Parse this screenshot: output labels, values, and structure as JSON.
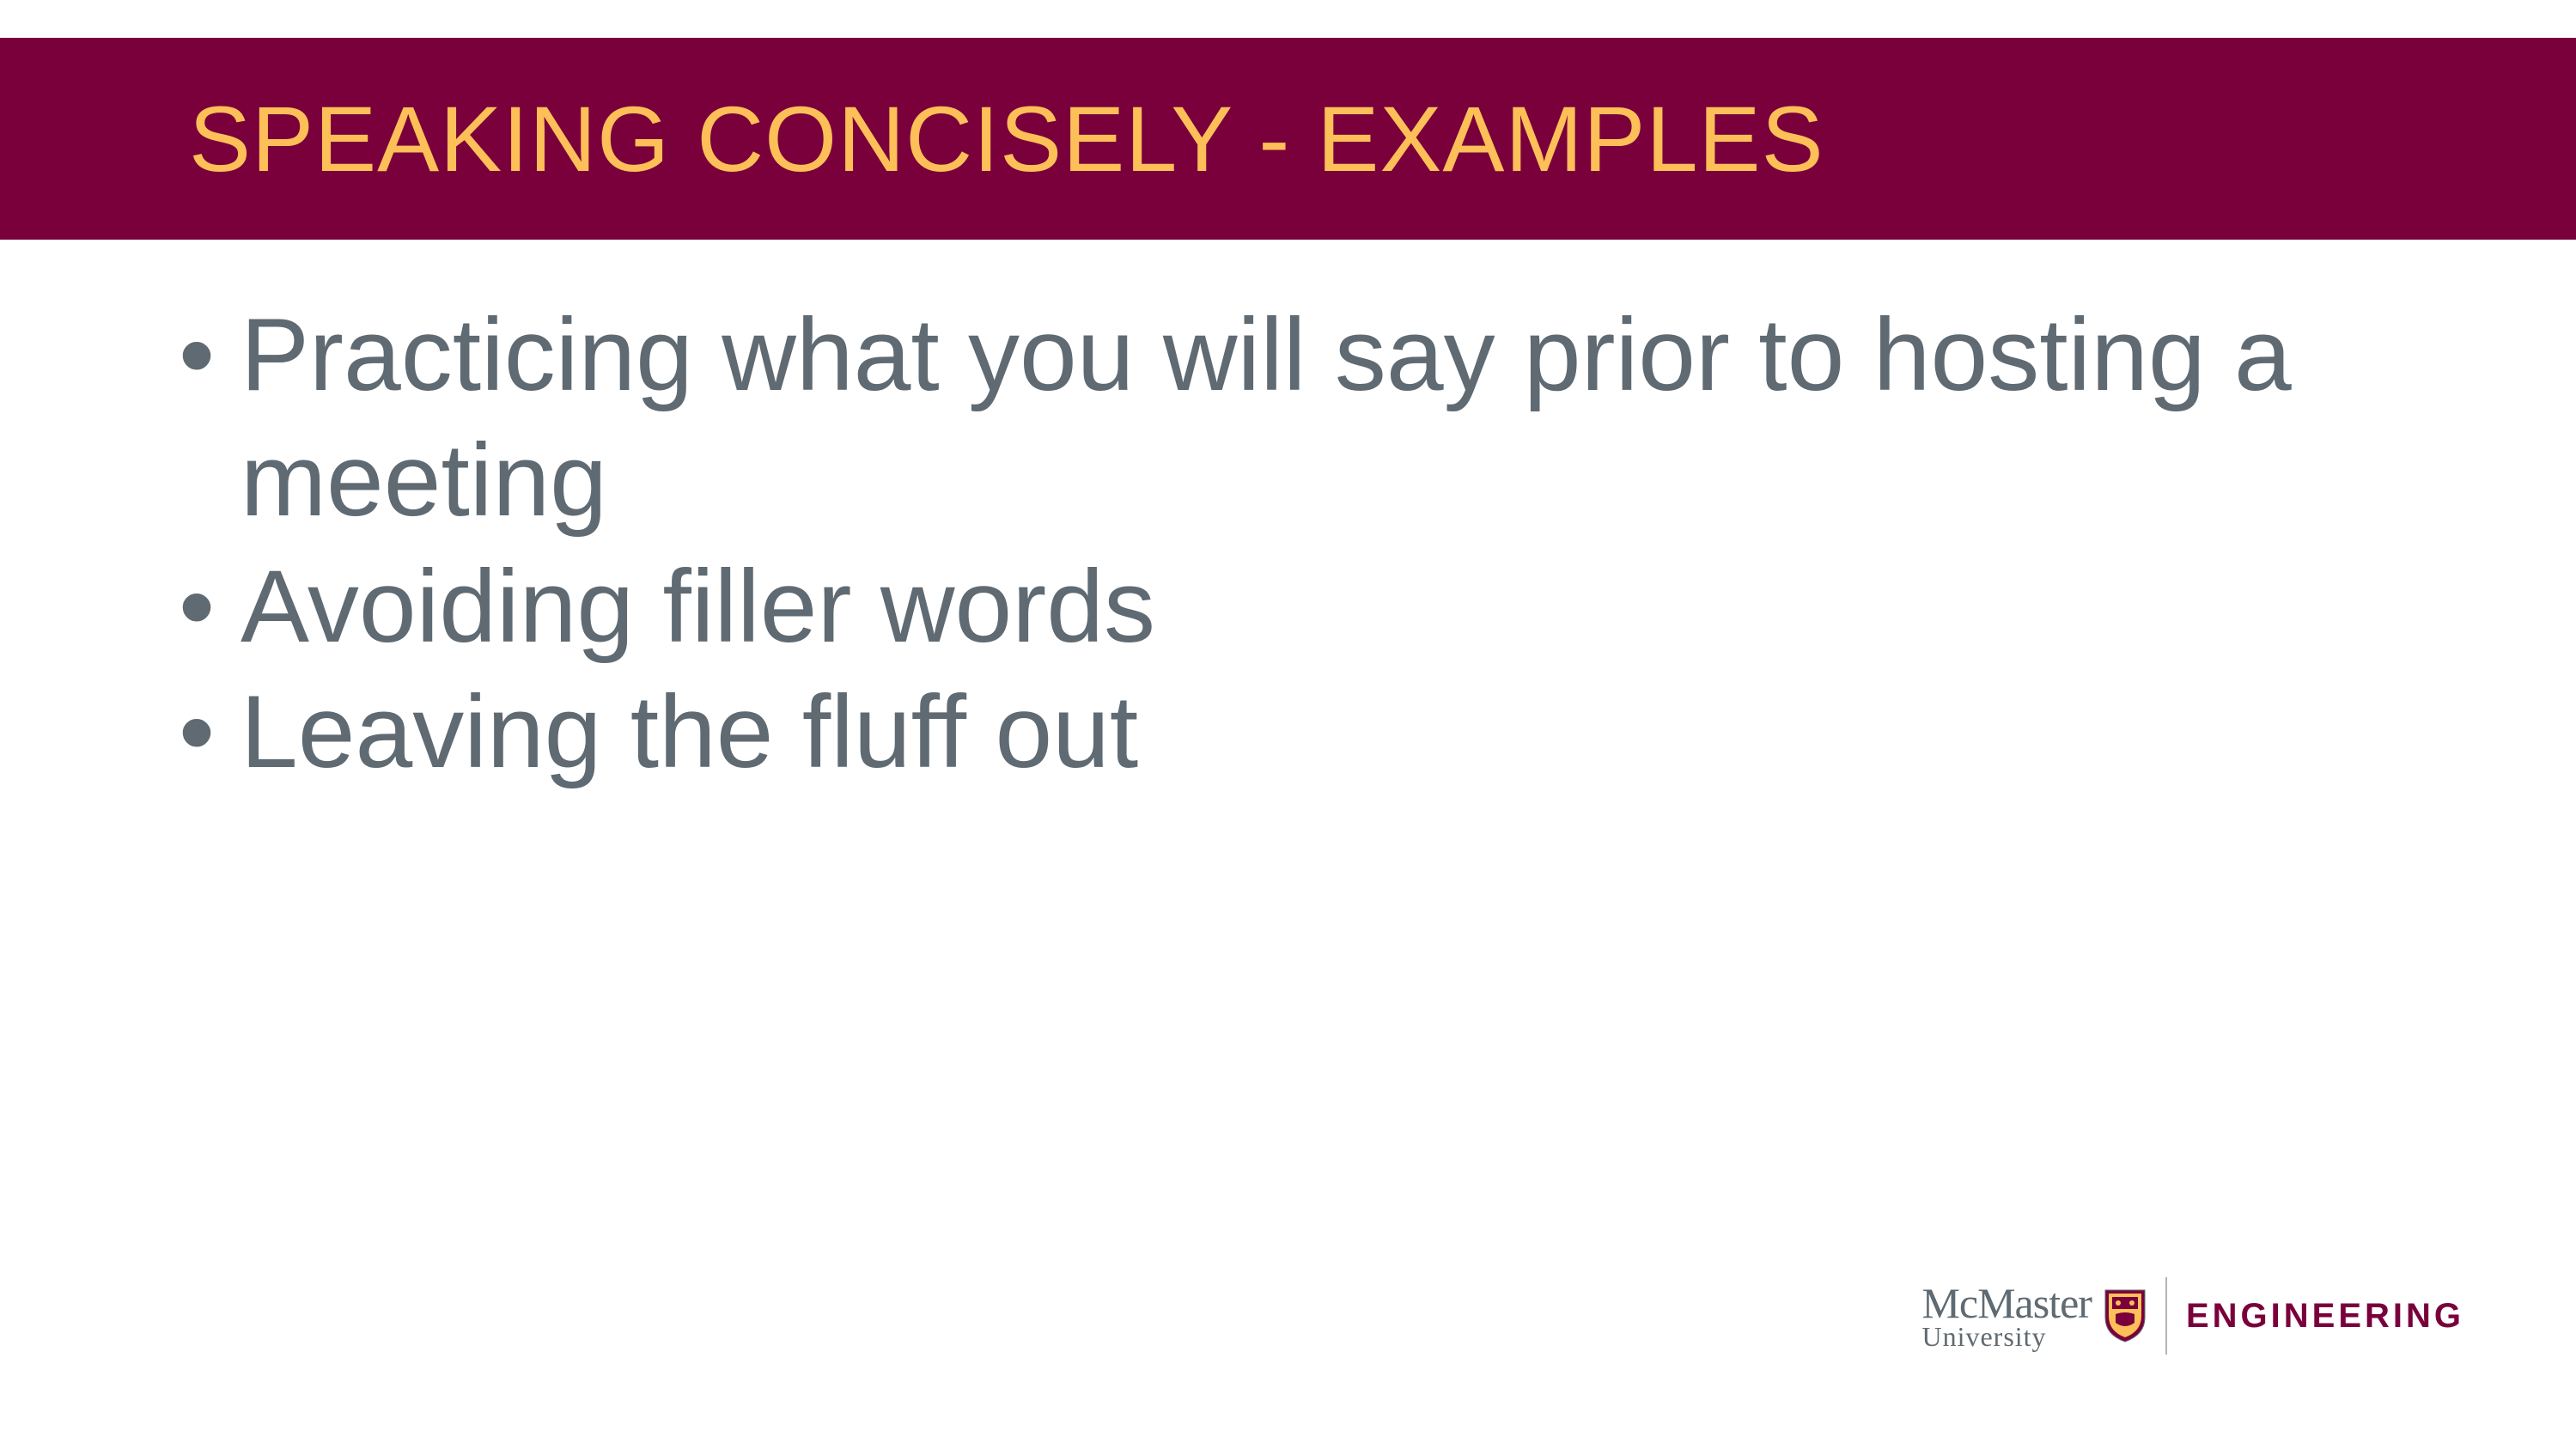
{
  "title": "SPEAKING CONCISELY - EXAMPLES",
  "bullets": [
    "Practicing what you will say prior to hosting a meeting",
    "Avoiding filler words",
    "Leaving the fluff out"
  ],
  "logo": {
    "line1": "McMaster",
    "line2": "University",
    "department": "ENGINEERING"
  },
  "colors": {
    "maroon": "#7a003c",
    "gold": "#fdbf57",
    "gray": "#5f6a72"
  }
}
